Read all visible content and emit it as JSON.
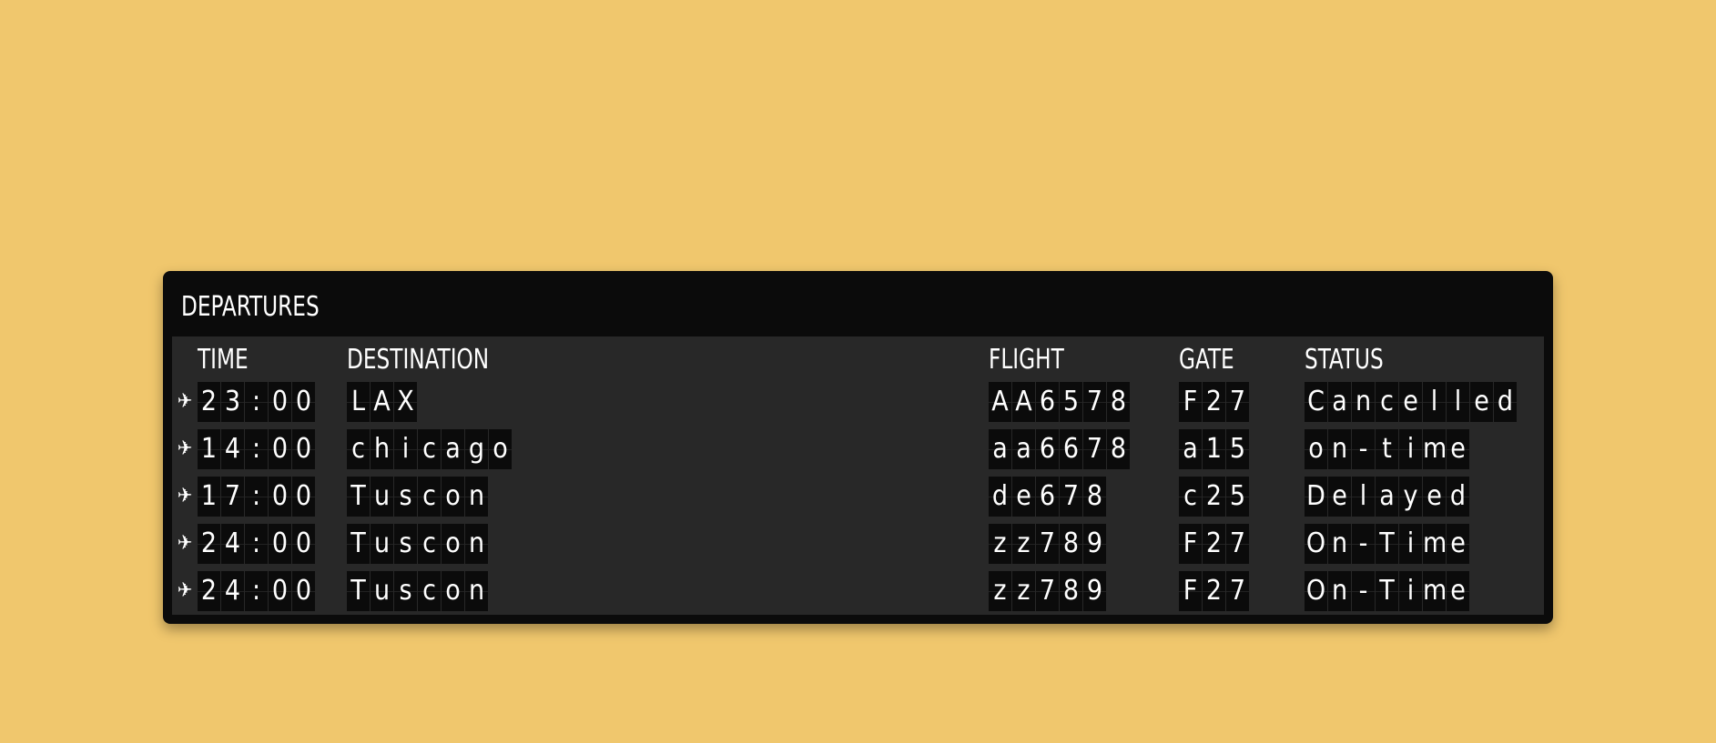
{
  "board": {
    "title": "DEPARTURES",
    "columns": {
      "time": "TIME",
      "destination": "DESTINATION",
      "flight": "FLIGHT",
      "gate": "GATE",
      "status": "STATUS"
    },
    "row_icon": "airplane-icon",
    "rows": [
      {
        "time": "23:00",
        "destination": "LAX",
        "flight": "AA6578",
        "gate": "F27",
        "status": "Cancelled"
      },
      {
        "time": "14:00",
        "destination": "chicago",
        "flight": "aa6678",
        "gate": "a15",
        "status": "on-time"
      },
      {
        "time": "17:00",
        "destination": "Tuscon",
        "flight": "de678",
        "gate": "c25",
        "status": "Delayed"
      },
      {
        "time": "24:00",
        "destination": "Tuscon",
        "flight": "zz789",
        "gate": "F27",
        "status": "On-Time"
      },
      {
        "time": "24:00",
        "destination": "Tuscon",
        "flight": "zz789",
        "gate": "F27",
        "status": "On-Time"
      }
    ]
  },
  "colors": {
    "background": "#f0c76d",
    "board": "#0b0b0b",
    "panel": "#282828",
    "text": "#ffffff"
  }
}
